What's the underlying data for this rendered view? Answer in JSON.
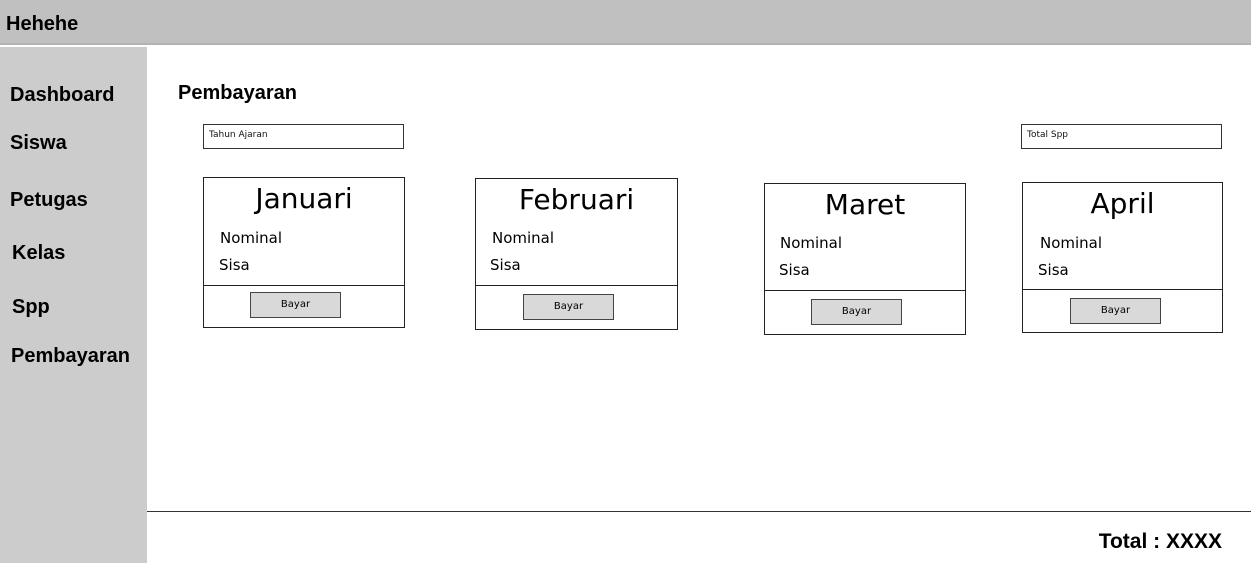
{
  "app": {
    "title": "Hehehe"
  },
  "sidebar": {
    "items": [
      {
        "label": "Dashboard"
      },
      {
        "label": "Siswa"
      },
      {
        "label": "Petugas"
      },
      {
        "label": "Kelas"
      },
      {
        "label": "Spp"
      },
      {
        "label": "Pembayaran"
      }
    ]
  },
  "main": {
    "title": "Pembayaran",
    "tahun_ajaran_placeholder": "Tahun Ajaran",
    "total_spp_placeholder": "Total Spp",
    "cards": [
      {
        "month": "Januari",
        "nominal": "Nominal",
        "sisa": "Sisa",
        "button": "Bayar"
      },
      {
        "month": "Februari",
        "nominal": "Nominal",
        "sisa": "Sisa",
        "button": "Bayar"
      },
      {
        "month": "Maret",
        "nominal": "Nominal",
        "sisa": "Sisa",
        "button": "Bayar"
      },
      {
        "month": "April",
        "nominal": "Nominal",
        "sisa": "Sisa",
        "button": "Bayar"
      }
    ],
    "total": "Total : XXXX"
  }
}
